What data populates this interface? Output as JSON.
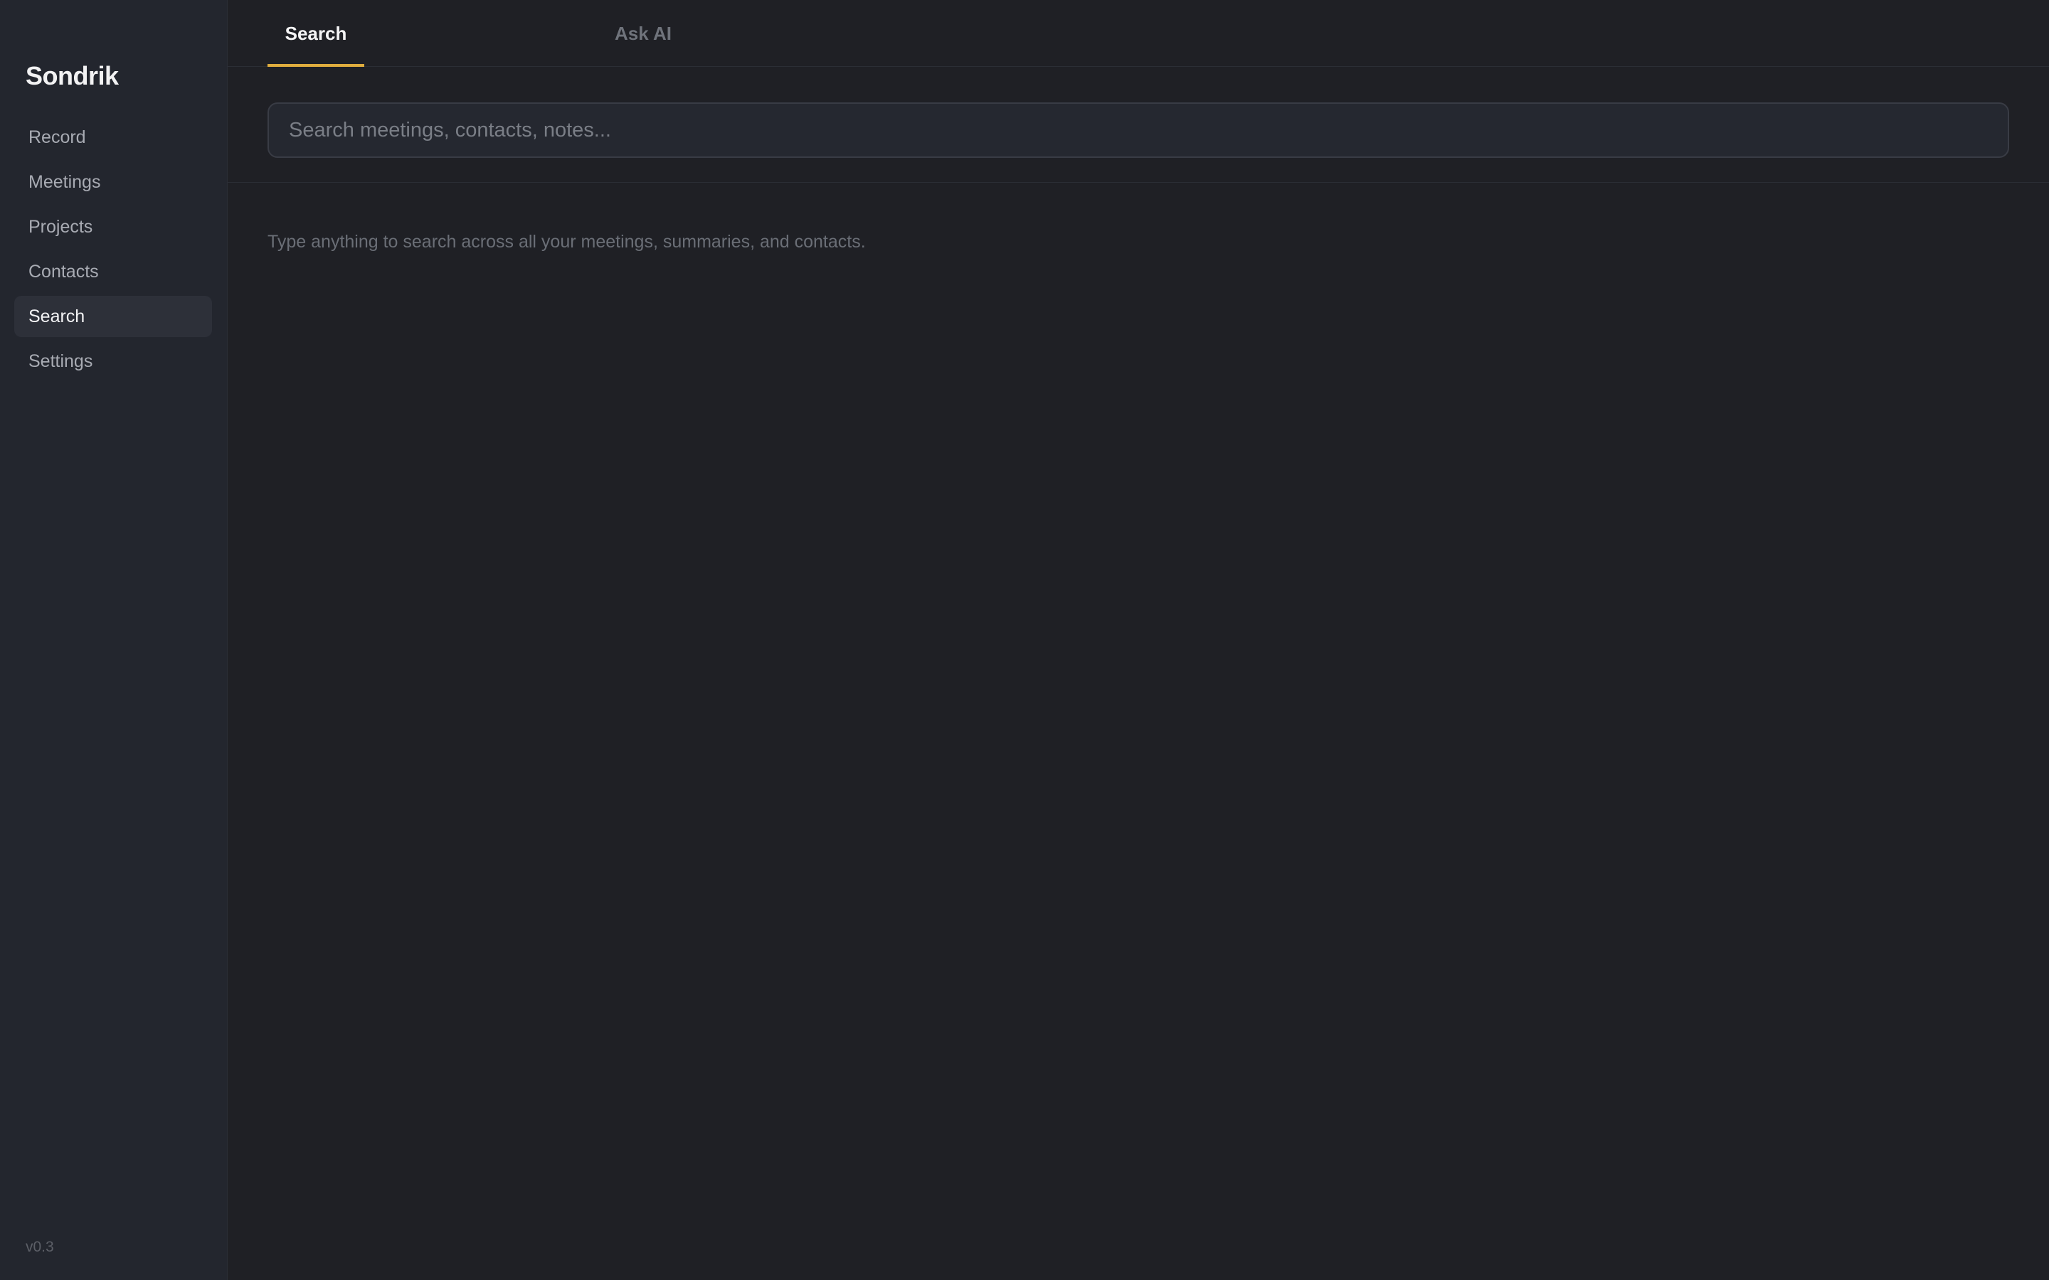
{
  "app": {
    "name": "Sondrik",
    "version": "v0.3"
  },
  "sidebar": {
    "items": [
      {
        "label": "Record",
        "active": false
      },
      {
        "label": "Meetings",
        "active": false
      },
      {
        "label": "Projects",
        "active": false
      },
      {
        "label": "Contacts",
        "active": false
      },
      {
        "label": "Search",
        "active": true
      },
      {
        "label": "Settings",
        "active": false
      }
    ]
  },
  "tabs": {
    "items": [
      {
        "label": "Search",
        "active": true
      },
      {
        "label": "Ask AI",
        "active": false
      }
    ]
  },
  "search": {
    "placeholder": "Search meetings, contacts, notes...",
    "value": "",
    "hint": "Type anything to search across all your meetings, summaries, and contacts."
  },
  "colors": {
    "accent": "#e0ad3e",
    "background": "#1f2025",
    "sidebar_background": "#23262e",
    "active_item_background": "#2d3039"
  }
}
